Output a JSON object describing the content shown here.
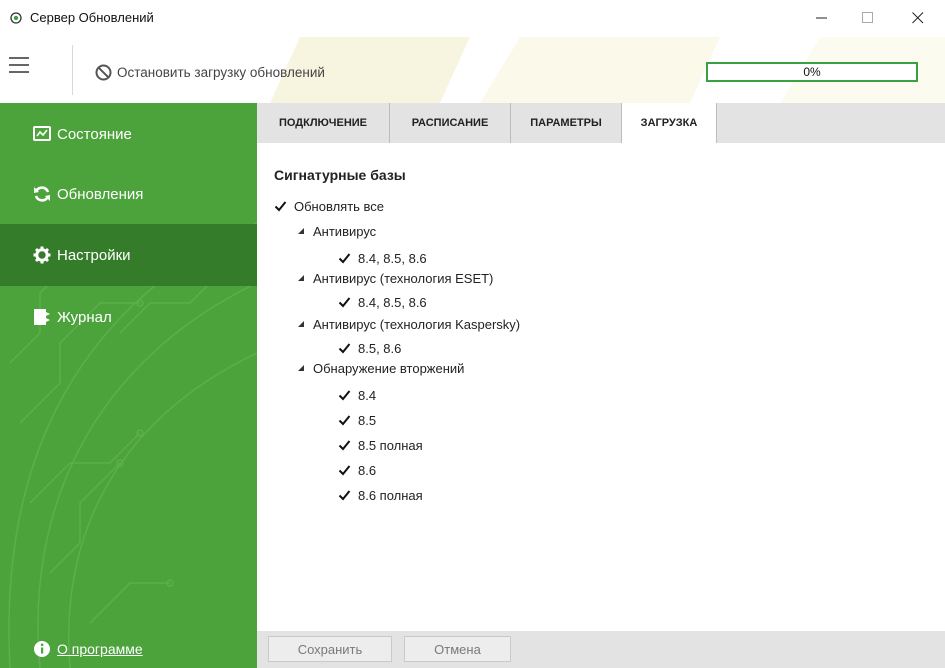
{
  "window": {
    "title": "Сервер Обновлений"
  },
  "toolbar": {
    "stop_label": "Остановить загрузку обновлений",
    "progress_text": "0%",
    "progress_value": 0
  },
  "sidebar": {
    "items": [
      {
        "label": "Состояние",
        "icon": "monitor-icon"
      },
      {
        "label": "Обновления",
        "icon": "refresh-icon"
      },
      {
        "label": "Настройки",
        "icon": "gear-icon",
        "active": true
      },
      {
        "label": "Журнал",
        "icon": "journal-icon"
      }
    ],
    "about_label": "О программе"
  },
  "tabs": [
    {
      "label": "ПОДКЛЮЧЕНИЕ"
    },
    {
      "label": "РАСПИСАНИЕ"
    },
    {
      "label": "ПАРАМЕТРЫ"
    },
    {
      "label": "ЗАГРУЗКА",
      "active": true
    }
  ],
  "content": {
    "section_title": "Сигнатурные базы",
    "update_all": "Обновлять все",
    "groups": [
      {
        "name": "Антивирус",
        "items": [
          "8.4, 8.5, 8.6"
        ]
      },
      {
        "name": "Антивирус (технология ESET)",
        "items": [
          "8.4, 8.5, 8.6"
        ]
      },
      {
        "name": "Антивирус (технология Kaspersky)",
        "items": [
          "8.5, 8.6"
        ]
      },
      {
        "name": "Обнаружение вторжений",
        "items": [
          "8.4",
          "8.5",
          "8.5 полная",
          "8.6",
          "8.6 полная"
        ]
      }
    ]
  },
  "footer": {
    "save_label": "Сохранить",
    "cancel_label": "Отмена"
  },
  "colors": {
    "accent": "#4ca33c",
    "accent_dark": "#357c2a",
    "progress": "#3aa142",
    "tabs_bg": "#e3e3e3"
  }
}
